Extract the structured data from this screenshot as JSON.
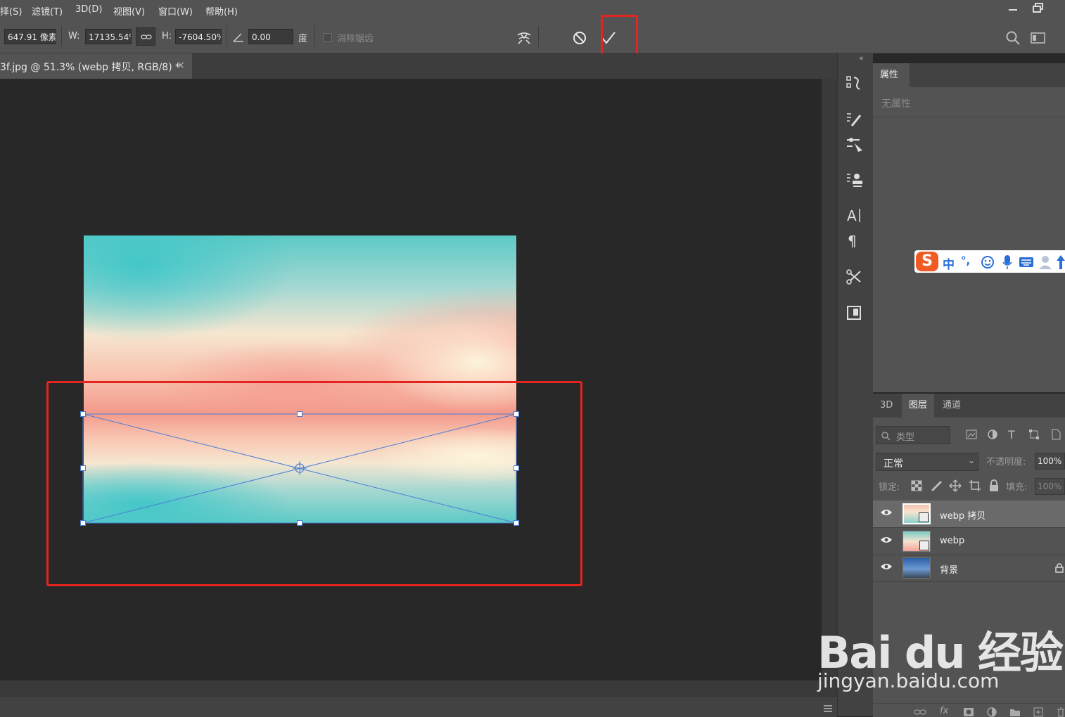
{
  "menu": {
    "items": [
      "择(S)",
      "滤镜(T)",
      "3D(D)",
      "视图(V)",
      "窗口(W)",
      "帮助(H)"
    ]
  },
  "options": {
    "x_value": "647.91 像素",
    "w_label": "W:",
    "w_value": "17135.54%",
    "h_label": "H:",
    "h_value": "-7604.50%",
    "angle_value": "0.00",
    "angle_unit": "度",
    "antialias_label": "消除锯齿"
  },
  "document": {
    "tab_title": "3f.jpg @ 51.3% (webp 拷贝, RGB/8) *",
    "close_glyph": "×"
  },
  "properties": {
    "tab_label": "属性",
    "empty_text": "无属性"
  },
  "layers_panel": {
    "tabs": [
      "3D",
      "图层",
      "通道"
    ],
    "active_tab": "图层",
    "filter_placeholder": "类型",
    "blend_mode": "正常",
    "opacity_label": "不透明度:",
    "opacity_value": "100%",
    "lock_label": "锁定:",
    "fill_label": "填充:",
    "fill_value": "100%",
    "layers": [
      {
        "name": "webp 拷贝",
        "selected": true
      },
      {
        "name": "webp",
        "selected": false
      },
      {
        "name": "背景",
        "selected": false,
        "locked": true
      }
    ]
  },
  "ime": {
    "lang": "中",
    "punct": "°,"
  },
  "watermark": {
    "brand": "Bai du 经验",
    "url": "jingyan.baidu.com"
  },
  "colors": {
    "highlight_red": "#e32420",
    "transform_blue": "#4a7dd8",
    "panel_bg": "#535353",
    "canvas_bg": "#282828"
  }
}
